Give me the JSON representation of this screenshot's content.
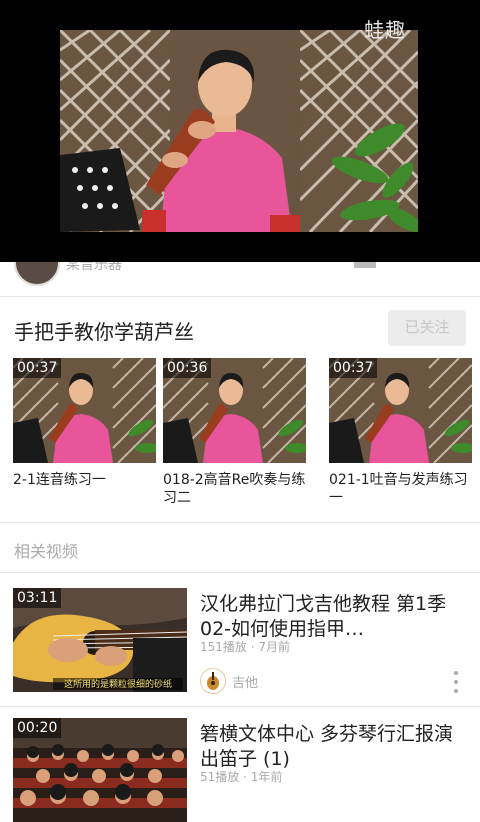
{
  "player": {
    "watermark": "蛙趣"
  },
  "channel_peek": {
    "name": "某音乐器"
  },
  "playlist": {
    "title": "手把手教你学葫芦丝",
    "follow_label": "已关注",
    "items": [
      {
        "duration": "00:37",
        "label": "2-1连音练习一"
      },
      {
        "duration": "00:36",
        "label": "018-2高音Re吹奏与练习二"
      },
      {
        "duration": "00:37",
        "label": "021-1吐音与发声练习一"
      }
    ]
  },
  "related": {
    "heading": "相关视频",
    "items": [
      {
        "duration": "03:11",
        "title": "汉化弗拉门戈吉他教程 第1季02-如何使用指甲…",
        "views": "151播放",
        "age": "7月前",
        "channel": "吉他",
        "subtitle": "这所用的是颗粒很细的砂纸"
      },
      {
        "duration": "00:20",
        "title": "箬横文体中心 多芬琴行汇报演出笛子 (1)",
        "views": "51播放",
        "age": "1年前"
      }
    ]
  },
  "colors": {
    "accent_text": "#222222",
    "secondary_text": "#aaaaaa",
    "follow_bg": "#ececec",
    "shirt_pink": "#e8559b"
  },
  "icons": [
    "more-vertical-icon"
  ]
}
